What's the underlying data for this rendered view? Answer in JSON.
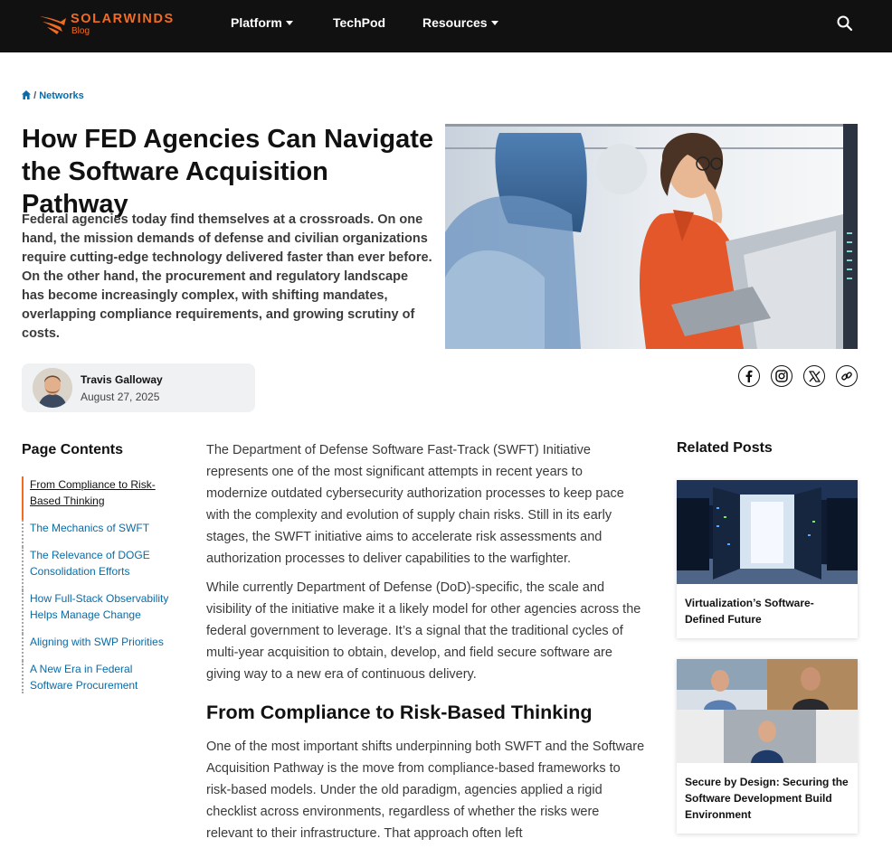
{
  "header": {
    "logo_word": "SOLARWINDS",
    "logo_sub": "Blog",
    "nav": [
      {
        "label": "Platform",
        "has_dropdown": true
      },
      {
        "label": "TechPod",
        "has_dropdown": false
      },
      {
        "label": "Resources",
        "has_dropdown": true
      }
    ],
    "search_icon": "search-icon"
  },
  "breadcrumb": {
    "home_icon": "home-icon",
    "separator": "/",
    "category": "Networks"
  },
  "article": {
    "title": "How FED Agencies Can Navigate the Software Acquisition Pathway",
    "intro": "Federal agencies today find themselves at a crossroads. On one hand, the mission demands of defense and civilian organizations require cutting-edge technology delivered faster than ever before. On the other hand, the procurement and regulatory landscape has become increasingly complex, with shifting mandates, overlapping compliance requirements, and growing scrutiny of costs.",
    "author": {
      "name": "Travis Galloway",
      "date": "August 27, 2025"
    },
    "share_icons": [
      "facebook-icon",
      "instagram-icon",
      "x-icon",
      "link-icon"
    ],
    "paragraphs": [
      "The Department of Defense Software Fast-Track (SWFT) Initiative represents one of the most significant attempts in recent years to modernize outdated cybersecurity authorization processes to keep pace with the complexity and evolution of supply chain risks. Still in its early stages, the SWFT initiative aims to accelerate risk assessments and authorization processes to deliver capabilities to the warfighter.",
      "While currently Department of Defense (DoD)-specific, the scale and visibility of the initiative make it a likely model for other agencies across the federal government to leverage. It’s a signal that the traditional cycles of multi-year acquisition to obtain, develop, and field secure software are giving way to a new era of continuous delivery."
    ],
    "section_heading": "From Compliance to Risk-Based Thinking",
    "section_paragraph": "One of the most important shifts underpinning both SWFT and the Software Acquisition Pathway is the move from compliance-based frameworks to risk-based models. Under the old paradigm, agencies applied a rigid checklist across environments, regardless of whether the risks were relevant to their infrastructure. That approach often left"
  },
  "toc": {
    "title": "Page Contents",
    "items": [
      {
        "label": "From Compliance to Risk-Based Thinking",
        "active": true
      },
      {
        "label": "The Mechanics of SWFT",
        "active": false
      },
      {
        "label": "The Relevance of DOGE Consolidation Efforts",
        "active": false
      },
      {
        "label": "How Full-Stack Observability Helps Manage Change",
        "active": false
      },
      {
        "label": "Aligning with SWP Priorities",
        "active": false
      },
      {
        "label": "A New Era in Federal Software Procurement",
        "active": false
      }
    ]
  },
  "related": {
    "title": "Related Posts",
    "posts": [
      {
        "title": "Virtualization’s Software-Defined Future"
      },
      {
        "title": "Secure by Design: Securing the Software Development Build Environment"
      }
    ]
  },
  "colors": {
    "brand_orange": "#f26b21",
    "link_blue": "#0a6ba6",
    "nav_bg": "#111111"
  }
}
